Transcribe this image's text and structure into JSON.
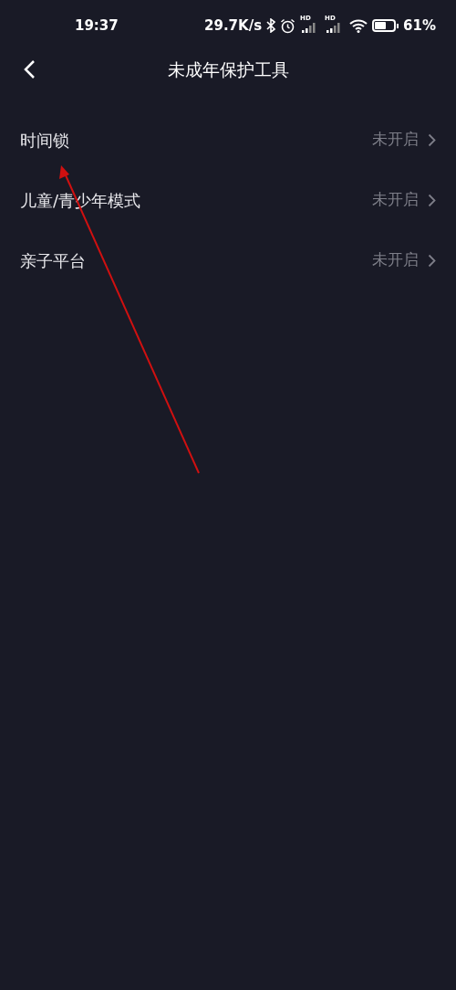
{
  "status_bar": {
    "time": "19:37",
    "net_speed": "29.7K/s",
    "signals": [
      {
        "label": "HD"
      },
      {
        "label": "HD"
      }
    ],
    "battery": {
      "text": "61%"
    }
  },
  "header": {
    "title": "未成年保护工具"
  },
  "items": [
    {
      "label": "时间锁",
      "status": "未开启"
    },
    {
      "label": "儿童/青少年模式",
      "status": "未开启"
    },
    {
      "label": "亲子平台",
      "status": "未开启"
    }
  ]
}
